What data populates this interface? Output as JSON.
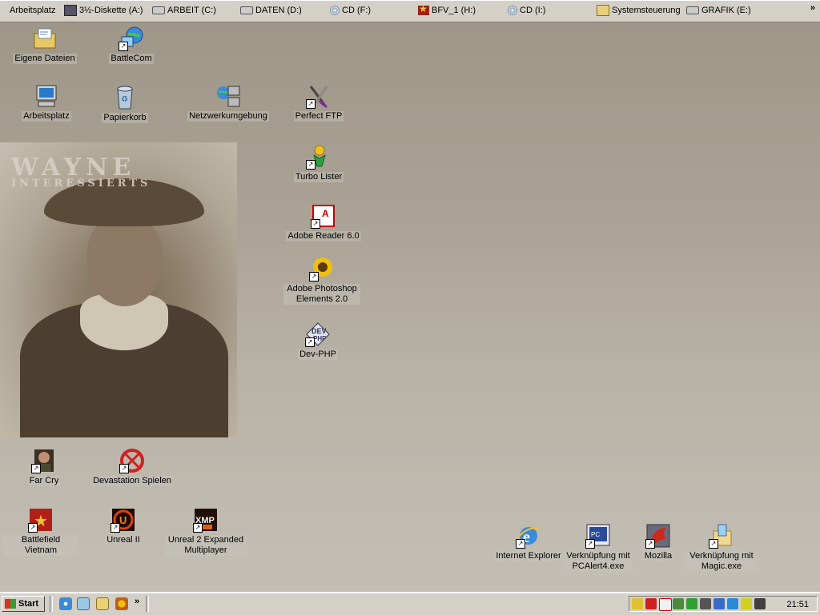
{
  "top_toolbar": {
    "items": [
      {
        "label": "Arbeitsplatz",
        "icon": "none"
      },
      {
        "label": "3½-Diskette (A:)",
        "icon": "floppy-icon"
      },
      {
        "label": "ARBEIT (C:)",
        "icon": "drive-icon"
      },
      {
        "label": "DATEN (D:)",
        "icon": "drive-icon"
      },
      {
        "label": "CD (F:)",
        "icon": "cd-icon"
      },
      {
        "label": "BFV_1 (H:)",
        "icon": "star-icon"
      },
      {
        "label": "CD (I:)",
        "icon": "cd-icon"
      },
      {
        "label": "Systemsteuerung",
        "icon": "folder-icon"
      },
      {
        "label": "GRAFIK (E:)",
        "icon": "drive-icon"
      }
    ],
    "overflow_label": "»"
  },
  "wallpaper": {
    "title": "WAYNE",
    "subtitle": "INTERESSIERTS"
  },
  "desktop_icons": [
    {
      "label": "Eigene Dateien",
      "icon": "documents-folder-icon"
    },
    {
      "label": "BattleCom",
      "icon": "network-globe-icon"
    },
    {
      "label": "Arbeitsplatz",
      "icon": "computer-icon"
    },
    {
      "label": "Papierkorb",
      "icon": "recycle-bin-icon"
    },
    {
      "label": "Netzwerkumgebung",
      "icon": "network-icon"
    },
    {
      "label": "Perfect FTP",
      "icon": "ftp-icon"
    },
    {
      "label": "Turbo Lister",
      "icon": "turbo-lister-icon"
    },
    {
      "label": "Adobe Reader 6.0",
      "icon": "adobe-reader-icon"
    },
    {
      "label": "Adobe Photoshop Elements 2.0",
      "icon": "sunflower-icon"
    },
    {
      "label": "Dev-PHP",
      "icon": "dev-php-icon"
    },
    {
      "label": "Far Cry",
      "icon": "far-cry-icon"
    },
    {
      "label": "Devastation Spielen",
      "icon": "devastation-icon"
    },
    {
      "label": "Battlefield Vietnam",
      "icon": "battlefield-icon"
    },
    {
      "label": "Unreal II",
      "icon": "unreal-icon"
    },
    {
      "label": "Unreal 2 Expanded Multiplayer",
      "icon": "xmp-icon"
    },
    {
      "label": "Internet Explorer",
      "icon": "internet-explorer-icon"
    },
    {
      "label": "Verknüpfung mit PCAlert4.exe",
      "icon": "pcalert-icon"
    },
    {
      "label": "Mozilla",
      "icon": "mozilla-icon"
    },
    {
      "label": "Verknüpfung mit Magic.exe",
      "icon": "magic-icon"
    }
  ],
  "taskbar": {
    "start_label": "Start",
    "quicklaunch_overflow": "»",
    "clock": "21:51"
  },
  "colors": {
    "desktop_top": "#9d9586",
    "desktop_bottom": "#c5c0b6",
    "chrome": "#d4d0c8"
  }
}
